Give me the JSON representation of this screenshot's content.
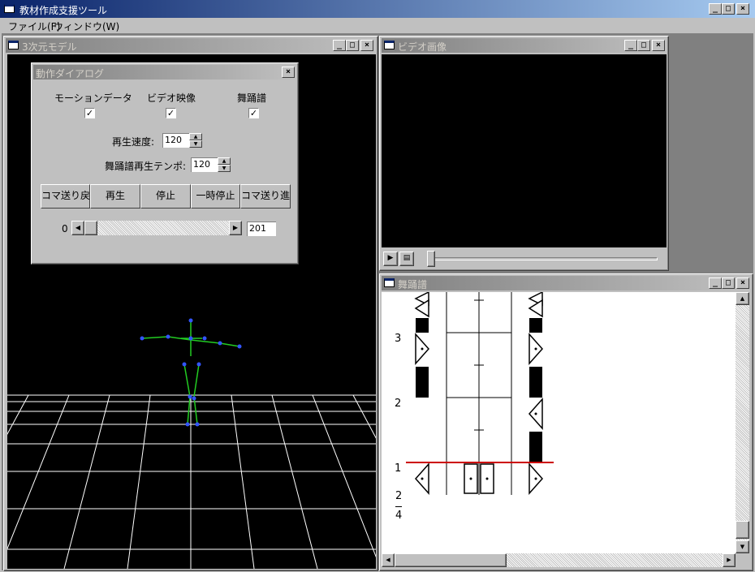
{
  "app": {
    "title": "教材作成支援ツール"
  },
  "menu": [
    {
      "label": "ファイル(F)"
    },
    {
      "label": "ウィンドウ(W)"
    }
  ],
  "model_window": {
    "title": "3次元モデル"
  },
  "dialog": {
    "title": "動作ダイアログ",
    "checks": [
      {
        "label": "モーションデータ",
        "checked": "✓"
      },
      {
        "label": "ビデオ映像",
        "checked": "✓"
      },
      {
        "label": "舞踊譜",
        "checked": "✓"
      }
    ],
    "speed_label": "再生速度:",
    "speed_value": "120",
    "tempo_label": "舞踊譜再生テンポ:",
    "tempo_value": "120",
    "buttons": [
      {
        "label": "コマ送り戻"
      },
      {
        "label": "再生"
      },
      {
        "label": "停止"
      },
      {
        "label": "一時停止"
      },
      {
        "label": "コマ送り進"
      }
    ],
    "slider_min": "0",
    "frame_value": "201",
    "frame_position": 0.0
  },
  "video_window": {
    "title": "ビデオ画像",
    "play_icon": "play-icon",
    "stop_icon": "stop-icon"
  },
  "score_window": {
    "title": "舞踊譜",
    "measures": [
      "3",
      "2",
      "1"
    ],
    "time_sig_top": "2",
    "time_sig_bottom": "4",
    "cursor_color": "#cc0000"
  },
  "window_buttons": {
    "minimize": "_",
    "maximize": "□",
    "close": "×"
  }
}
